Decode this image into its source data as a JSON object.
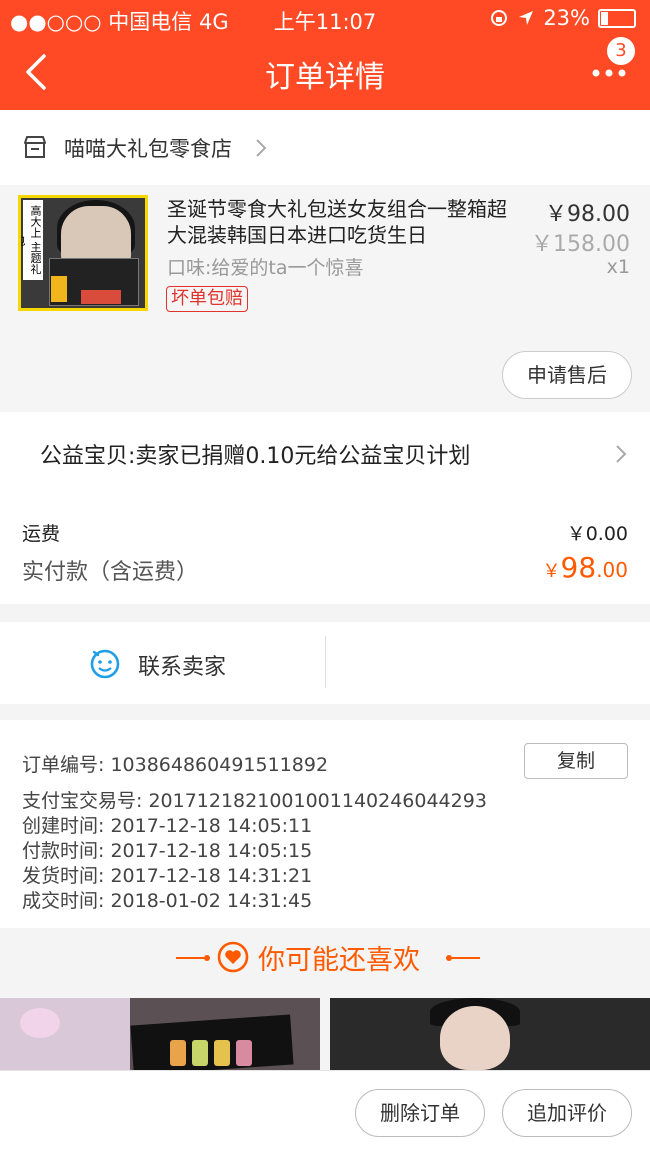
{
  "status_bar": {
    "carrier": "●●○○○ 中国电信  4G",
    "time": "上午11:07",
    "battery": "23%"
  },
  "header": {
    "title": "订单详情",
    "badge": "3"
  },
  "shop": {
    "name": "喵喵大礼包零食店"
  },
  "product": {
    "title": "圣诞节零食大礼包送女友组合一整箱超大混装韩国日本进口吃货生日",
    "variant": "口味:给爱的ta一个惊喜",
    "guarantee": "坏单包赔",
    "price": "￥98.00",
    "original_price": "￥158.00",
    "quantity": "x1",
    "after_sale_button": "申请售后",
    "thumb_tag": "高大上 主题礼包"
  },
  "charity": {
    "text": "公益宝贝:卖家已捐赠0.10元给公益宝贝计划"
  },
  "fees": {
    "shipping_label": "运费",
    "shipping_value": "￥0.00",
    "total_label": "实付款（含运费）",
    "total_currency": "￥",
    "total_int": "98",
    "total_dec": ".00"
  },
  "contact": {
    "label": "联系卖家"
  },
  "order_info": {
    "order_no": "订单编号:  103864860491511892",
    "alipay_no": "支付宝交易号:  2017121821001001140246044293",
    "created": "创建时间:  2017-12-18 14:05:11",
    "paid": "付款时间:  2017-12-18 14:05:15",
    "shipped": "发货时间:  2017-12-18 14:31:21",
    "completed": "成交时间:  2018-01-02 14:31:45",
    "copy_button": "复制"
  },
  "recommend": {
    "title": "你可能还喜欢"
  },
  "bottom": {
    "delete_button": "删除订单",
    "review_button": "追加评价"
  },
  "colors": {
    "brand": "#ff4a25",
    "accent": "#ff5a00",
    "link": "#1e9fe8"
  }
}
